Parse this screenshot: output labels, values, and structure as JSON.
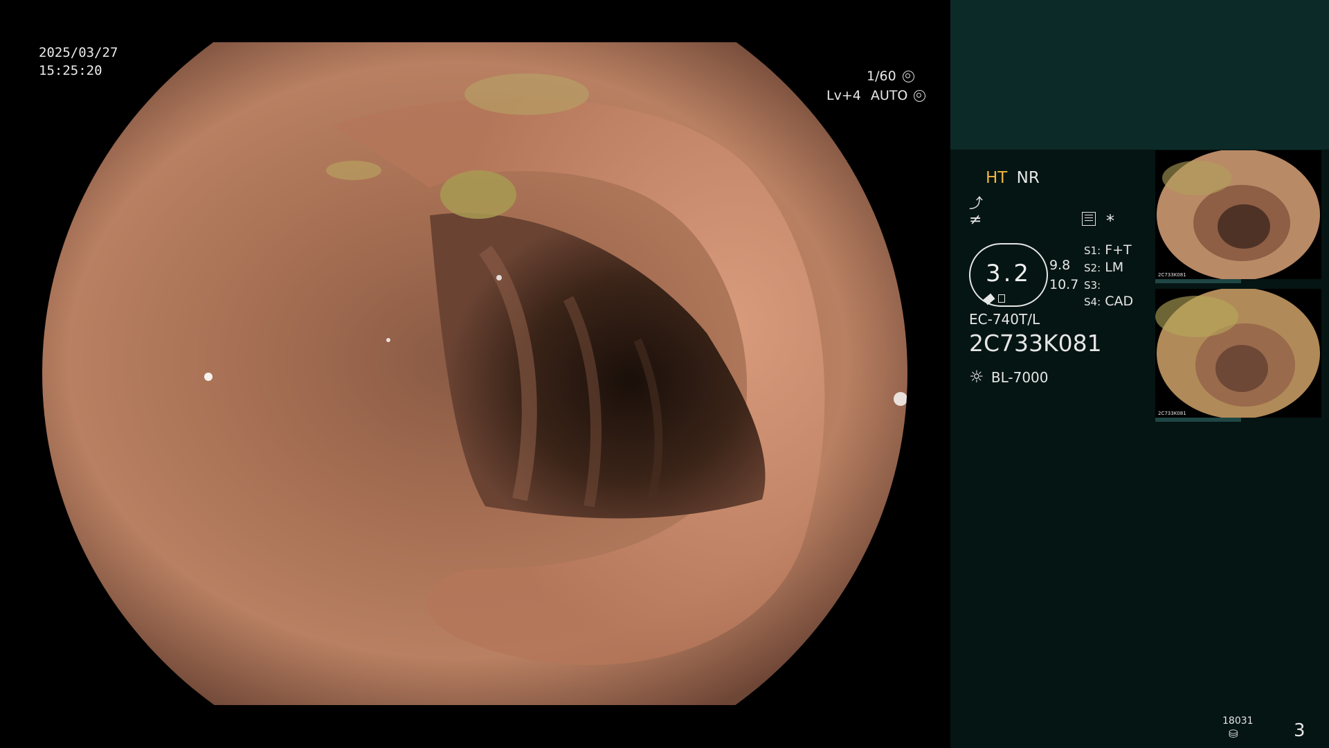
{
  "overlay": {
    "date": "2025/03/27",
    "time": "15:25:20",
    "shutter": "1/60",
    "level": "Lv+4",
    "iris_mode": "AUTO"
  },
  "status": {
    "ht_label": "HT",
    "nr_label": "NR",
    "gain_value": "3.2",
    "gain_sub_1": "9.8",
    "gain_sub_2": "10.7",
    "s1_key": "S1",
    "s1_value": "F+T",
    "s2_key": "S2",
    "s2_value": "LM",
    "s3_key": "S3",
    "s3_value": "",
    "s4_key": "S4",
    "s4_value": "CAD",
    "asterisk": "*",
    "scope_model": "EC-740T/L",
    "scope_serial": "2C733K081",
    "light_source": "BL-7000",
    "storage_count": "18031",
    "page_number": "3"
  },
  "thumbnails": [
    {
      "model": "2C733K081"
    },
    {
      "model": "2C733K081"
    }
  ],
  "colors": {
    "accent_ht": "#f0b640",
    "panel_bg": "#051513",
    "panel_top": "#0c2a28",
    "tissue": "#b07858"
  },
  "icons": [
    "shutter-icon",
    "iris-icon",
    "freeze-icon",
    "enhance-icon",
    "menu-icon",
    "light-icon",
    "storage-icon"
  ]
}
